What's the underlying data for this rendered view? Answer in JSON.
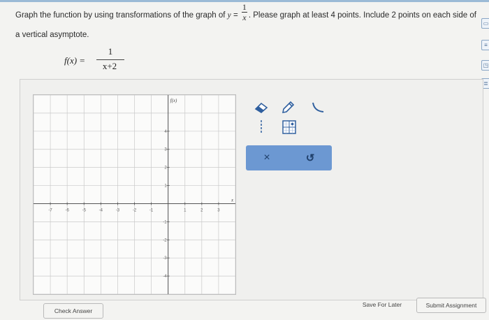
{
  "question": {
    "text_before": "Graph the function by using transformations of the graph of ",
    "y_var": "y",
    "equals": " = ",
    "frac_num": "1",
    "frac_den": "x",
    "text_after": ". Please graph at least 4 points. Include 2 points on each side of",
    "line2": "a vertical asymptote."
  },
  "function": {
    "lhs": "f(x) =",
    "numerator": "1",
    "denominator": "x+2"
  },
  "graph": {
    "y_axis_label": "f(x)",
    "x_axis_label": "x",
    "x_ticks": [
      "-7",
      "-6",
      "-5",
      "-4",
      "-3",
      "-2",
      "-1",
      "1",
      "2",
      "3"
    ],
    "y_ticks": [
      "4",
      "3",
      "2",
      "1",
      "-1",
      "-2",
      "-3",
      "-4"
    ]
  },
  "tools": {
    "eraser": "eraser-icon",
    "pencil": "pencil-icon",
    "curve": "curve-icon",
    "dashed_line": "dashed-line-icon",
    "point": "point-grid-icon",
    "clear": "×",
    "undo": "↺"
  },
  "buttons": {
    "check": "Check Answer",
    "save": "Save For Later",
    "submit": "Submit Assignment"
  },
  "sidebar_icons": [
    "▭",
    "≡",
    "◳",
    "≣",
    "▤"
  ],
  "colors": {
    "accent": "#6c98d2",
    "tool_icon": "#2f5f9e"
  }
}
